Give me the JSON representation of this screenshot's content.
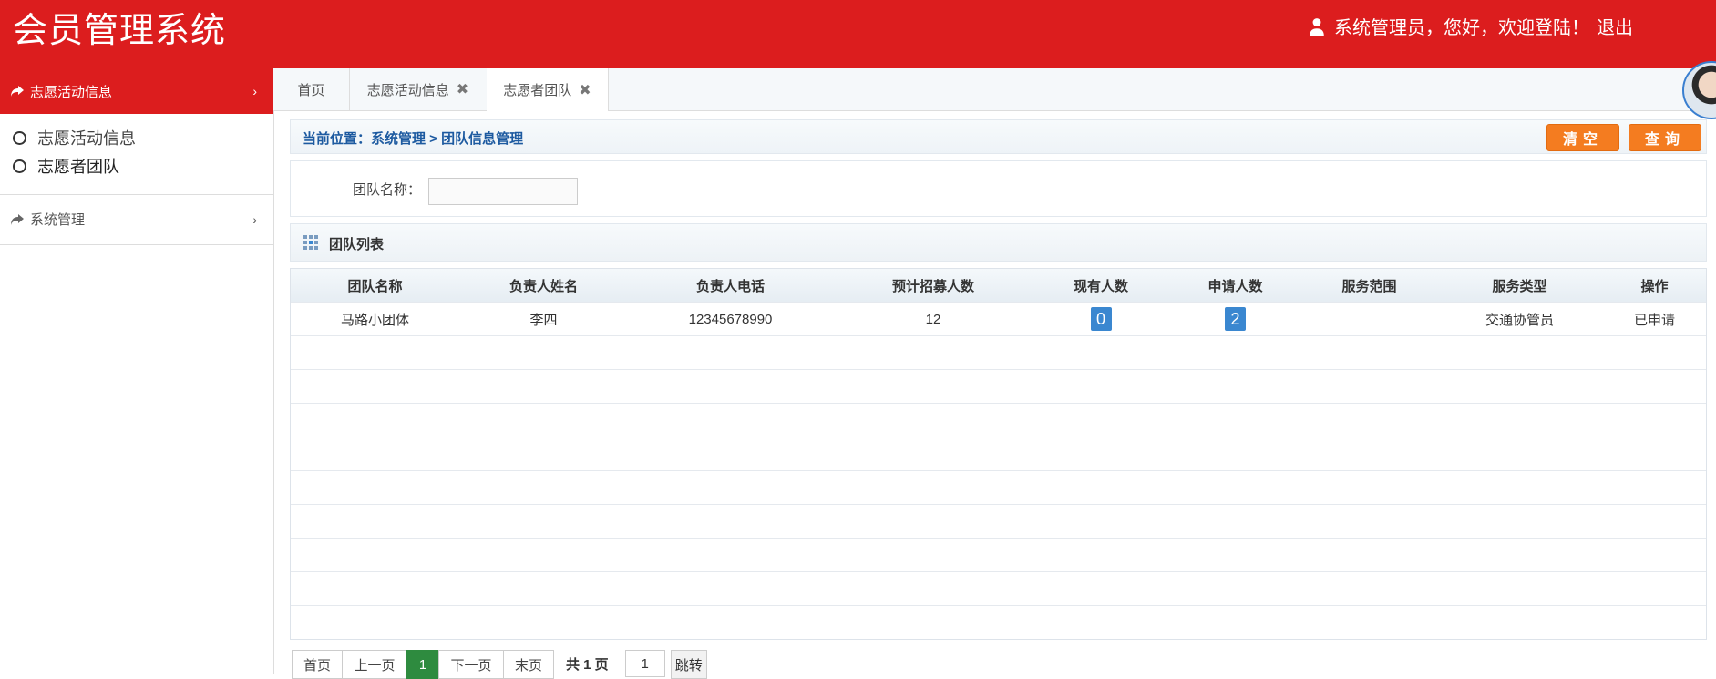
{
  "app": {
    "title": "会员管理系统"
  },
  "header": {
    "greeting": "系统管理员，您好，欢迎登陆！",
    "logout": "退出",
    "user_icon": "user-icon"
  },
  "sidebar": {
    "group1": {
      "label": "志愿活动信息",
      "icon": "share-icon"
    },
    "items": [
      {
        "label": "志愿活动信息"
      },
      {
        "label": "志愿者团队"
      }
    ],
    "group2": {
      "label": "系统管理",
      "icon": "share-icon"
    }
  },
  "tabs": [
    {
      "label": "首页"
    },
    {
      "label": "志愿活动信息"
    },
    {
      "label": "志愿者团队"
    }
  ],
  "breadcrumb": {
    "text": "当前位置：系统管理 > 团队信息管理"
  },
  "buttons": {
    "clear": "清空",
    "query": "查询"
  },
  "search": {
    "label": "团队名称：",
    "value": ""
  },
  "list": {
    "title": "团队列表",
    "icon": "grid-icon"
  },
  "table": {
    "headers": [
      "团队名称",
      "负责人姓名",
      "负责人电话",
      "预计招募人数",
      "现有人数",
      "申请人数",
      "服务范围",
      "服务类型",
      "操作"
    ],
    "rows": [
      {
        "team": "马路小团体",
        "leader": "李四",
        "phone": "12345678990",
        "planned": "12",
        "current": "0",
        "applied": "2",
        "scope": "",
        "type": "交通协管员",
        "action": "已申请"
      }
    ]
  },
  "pager": {
    "first": "首页",
    "prev": "上一页",
    "current": "1",
    "next": "下一页",
    "last": "末页",
    "total": "共 1 页",
    "jump_value": "1",
    "jump": "跳转"
  }
}
